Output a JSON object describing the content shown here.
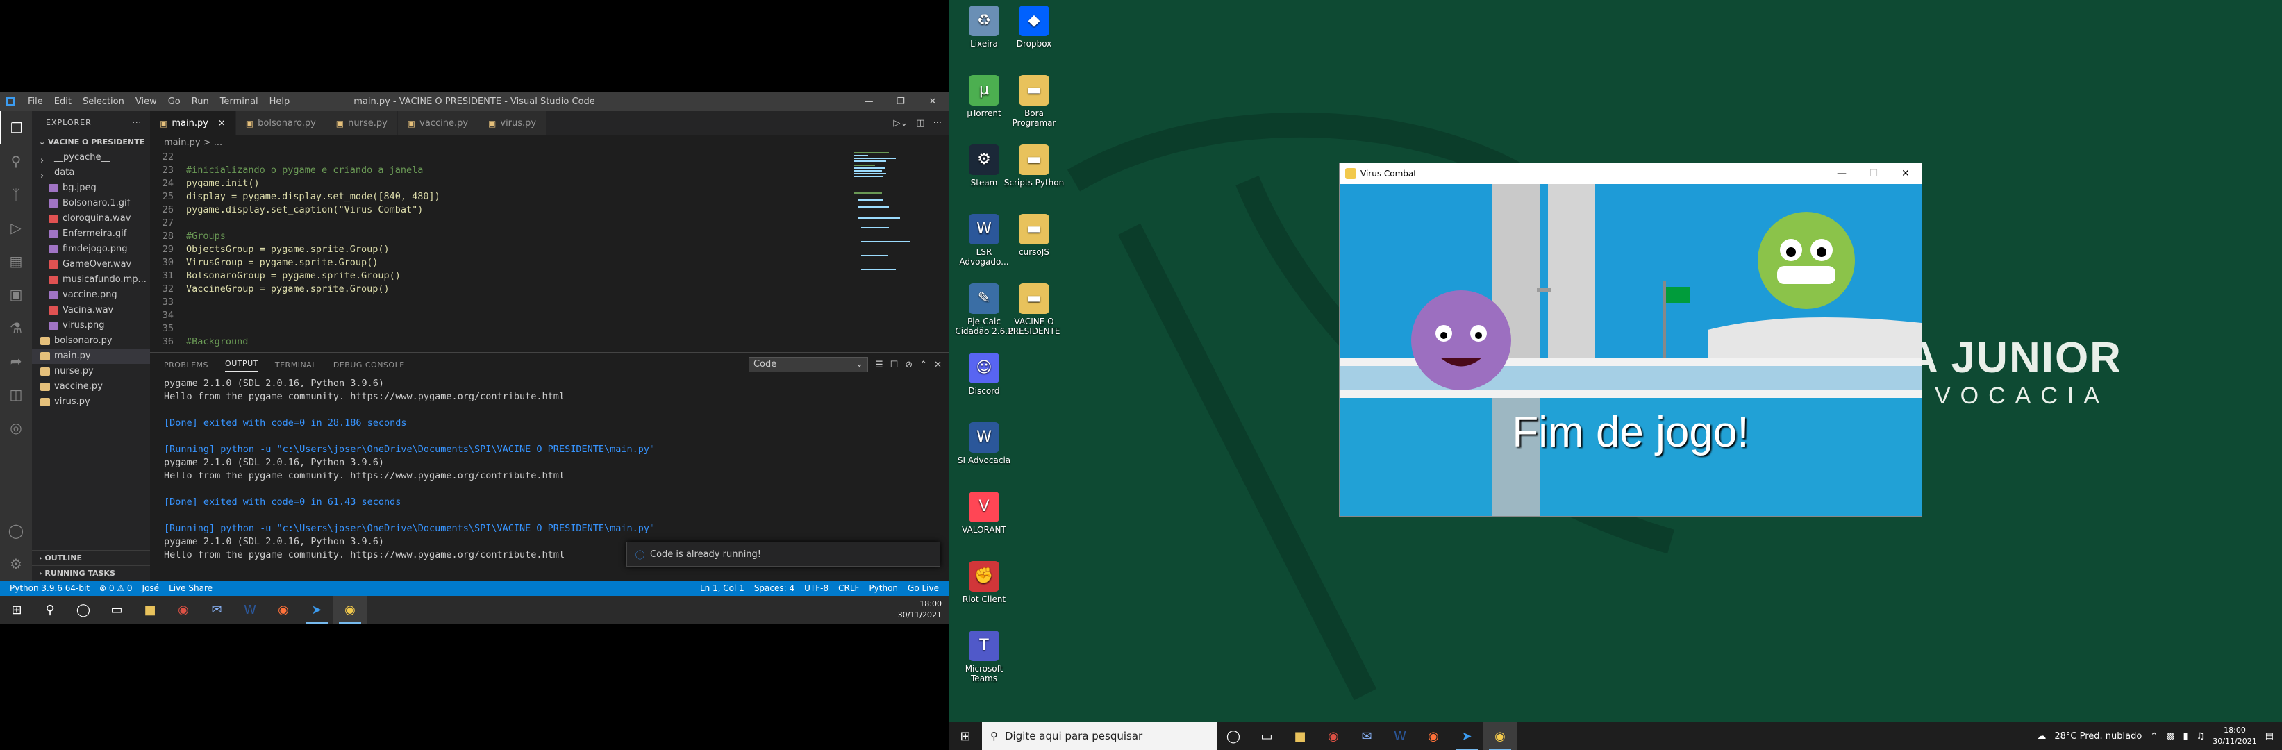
{
  "vscode": {
    "menu": [
      "File",
      "Edit",
      "Selection",
      "View",
      "Go",
      "Run",
      "Terminal",
      "Help"
    ],
    "title": "main.py - VACINE O PRESIDENTE - Visual Studio Code",
    "explorer": {
      "header": "EXPLORER",
      "project": "VACINE O PRESIDENTE",
      "items": [
        {
          "label": "__pycache__",
          "indent": 1,
          "color": "#c5c5c5",
          "folder": true
        },
        {
          "label": "data",
          "indent": 1,
          "color": "#c5c5c5",
          "folder": true
        },
        {
          "label": "bg.jpeg",
          "indent": 2,
          "color": "#a074c4"
        },
        {
          "label": "Bolsonaro.1.gif",
          "indent": 2,
          "color": "#a074c4"
        },
        {
          "label": "cloroquina.wav",
          "indent": 2,
          "color": "#e05252"
        },
        {
          "label": "Enfermeira.gif",
          "indent": 2,
          "color": "#a074c4"
        },
        {
          "label": "fimdejogo.png",
          "indent": 2,
          "color": "#a074c4"
        },
        {
          "label": "GameOver.wav",
          "indent": 2,
          "color": "#e05252"
        },
        {
          "label": "musicafundo.mp...",
          "indent": 2,
          "color": "#e05252"
        },
        {
          "label": "vaccine.png",
          "indent": 2,
          "color": "#a074c4"
        },
        {
          "label": "Vacina.wav",
          "indent": 2,
          "color": "#e05252"
        },
        {
          "label": "virus.png",
          "indent": 2,
          "color": "#a074c4"
        },
        {
          "label": "bolsonaro.py",
          "indent": 1,
          "color": "#e5c07b"
        },
        {
          "label": "main.py",
          "indent": 1,
          "color": "#e5c07b",
          "selected": true
        },
        {
          "label": "nurse.py",
          "indent": 1,
          "color": "#e5c07b"
        },
        {
          "label": "vaccine.py",
          "indent": 1,
          "color": "#e5c07b"
        },
        {
          "label": "virus.py",
          "indent": 1,
          "color": "#e5c07b"
        }
      ],
      "outline": "OUTLINE",
      "running": "RUNNING TASKS"
    },
    "tabs": [
      "main.py",
      "bolsonaro.py",
      "nurse.py",
      "vaccine.py",
      "virus.py"
    ],
    "breadcrumb": "main.py > ...",
    "code": [
      {
        "n": "22",
        "t": "",
        "c": ""
      },
      {
        "n": "23",
        "t": "#inicializando o pygame e criando a janela",
        "c": "cm"
      },
      {
        "n": "24",
        "t": "pygame.init()",
        "c": ""
      },
      {
        "n": "25",
        "t": "display = pygame.display.set_mode([840, 480])",
        "c": ""
      },
      {
        "n": "26",
        "t": "pygame.display.set_caption(\"Virus Combat\")",
        "c": ""
      },
      {
        "n": "27",
        "t": "",
        "c": ""
      },
      {
        "n": "28",
        "t": "#Groups",
        "c": "cm"
      },
      {
        "n": "29",
        "t": "ObjectsGroup = pygame.sprite.Group()",
        "c": ""
      },
      {
        "n": "30",
        "t": "VirusGroup = pygame.sprite.Group()",
        "c": ""
      },
      {
        "n": "31",
        "t": "BolsonaroGroup = pygame.sprite.Group()",
        "c": ""
      },
      {
        "n": "32",
        "t": "VaccineGroup = pygame.sprite.Group()",
        "c": ""
      },
      {
        "n": "33",
        "t": "",
        "c": ""
      },
      {
        "n": "34",
        "t": "",
        "c": ""
      },
      {
        "n": "35",
        "t": "",
        "c": ""
      },
      {
        "n": "36",
        "t": "#Background",
        "c": "cm"
      }
    ],
    "panel_tabs": [
      "PROBLEMS",
      "OUTPUT",
      "TERMINAL",
      "DEBUG CONSOLE"
    ],
    "output_channel": "Code",
    "output": [
      {
        "t": "pygame 2.1.0 (SDL 2.0.16, Python 3.9.6)",
        "c": ""
      },
      {
        "t": "Hello from the pygame community. https://www.pygame.org/contribute.html",
        "c": ""
      },
      {
        "t": "",
        "c": ""
      },
      {
        "t": "[Done] exited with code=0 in 28.186 seconds",
        "c": "blu"
      },
      {
        "t": "",
        "c": ""
      },
      {
        "t": "[Running] python -u \"c:\\Users\\joser\\OneDrive\\Documents\\SPI\\VACINE O PRESIDENTE\\main.py\"",
        "c": "blu"
      },
      {
        "t": "pygame 2.1.0 (SDL 2.0.16, Python 3.9.6)",
        "c": ""
      },
      {
        "t": "Hello from the pygame community. https://www.pygame.org/contribute.html",
        "c": ""
      },
      {
        "t": "",
        "c": ""
      },
      {
        "t": "[Done] exited with code=0 in 61.43 seconds",
        "c": "blu"
      },
      {
        "t": "",
        "c": ""
      },
      {
        "t": "[Running] python -u \"c:\\Users\\joser\\OneDrive\\Documents\\SPI\\VACINE O PRESIDENTE\\main.py\"",
        "c": "blu"
      },
      {
        "t": "pygame 2.1.0 (SDL 2.0.16, Python 3.9.6)",
        "c": ""
      },
      {
        "t": "Hello from the pygame community. https://www.pygame.org/contribute.html",
        "c": ""
      }
    ],
    "toast": "Code is already running!",
    "status_left": [
      "Python 3.9.6 64-bit",
      "⊗ 0 ⚠ 0",
      "José",
      "Live Share"
    ],
    "status_right": [
      "Ln 1, Col 1",
      "Spaces: 4",
      "UTF-8",
      "CRLF",
      "Python",
      "Go Live"
    ]
  },
  "taskbar1": {
    "time": "18:00",
    "date": "30/11/2021"
  },
  "desktop": {
    "brand_line1": "A JUNIOR",
    "brand_line2": "VOCACIA",
    "icons": [
      {
        "label": "Lixeira",
        "icon": "recycle-bin",
        "color": "#6a8fb5",
        "col": 0,
        "row": 0
      },
      {
        "label": "Dropbox",
        "icon": "dropbox",
        "color": "#0061fe",
        "col": 1,
        "row": 0
      },
      {
        "label": "µTorrent",
        "icon": "utorrent",
        "color": "#4caf50",
        "col": 0,
        "row": 1
      },
      {
        "label": "Bora Programar",
        "icon": "folder",
        "color": "#e8c25c",
        "col": 1,
        "row": 1
      },
      {
        "label": "Steam",
        "icon": "steam",
        "color": "#1b2838",
        "col": 0,
        "row": 2
      },
      {
        "label": "Scripts Python",
        "icon": "folder",
        "color": "#e8c25c",
        "col": 1,
        "row": 2
      },
      {
        "label": "LSR Advogado...",
        "icon": "word",
        "color": "#2b579a",
        "col": 0,
        "row": 3
      },
      {
        "label": "cursoJS",
        "icon": "folder",
        "color": "#e8c25c",
        "col": 1,
        "row": 3
      },
      {
        "label": "Pje-Calc Cidadão 2.6.2",
        "icon": "pje-calc",
        "color": "#3a6ea5",
        "col": 0,
        "row": 4
      },
      {
        "label": "VACINE O PRESIDENTE",
        "icon": "folder",
        "color": "#e8c25c",
        "col": 1,
        "row": 4
      },
      {
        "label": "Discord",
        "icon": "discord",
        "color": "#5865f2",
        "col": 0,
        "row": 5
      },
      {
        "label": "SI Advocacia",
        "icon": "word",
        "color": "#2b579a",
        "col": 0,
        "row": 6
      },
      {
        "label": "VALORANT",
        "icon": "valorant",
        "color": "#ff4655",
        "col": 0,
        "row": 7
      },
      {
        "label": "Riot Client",
        "icon": "riot",
        "color": "#d13639",
        "col": 0,
        "row": 8
      },
      {
        "label": "Microsoft Teams",
        "icon": "teams",
        "color": "#5059c9",
        "col": 0,
        "row": 9
      }
    ]
  },
  "game": {
    "title": "Virus Combat",
    "message": "Fim de jogo!"
  },
  "taskbar2": {
    "search_placeholder": "Digite aqui para pesquisar",
    "weather": "28°C  Pred. nublado",
    "time": "18:00",
    "date": "30/11/2021"
  }
}
